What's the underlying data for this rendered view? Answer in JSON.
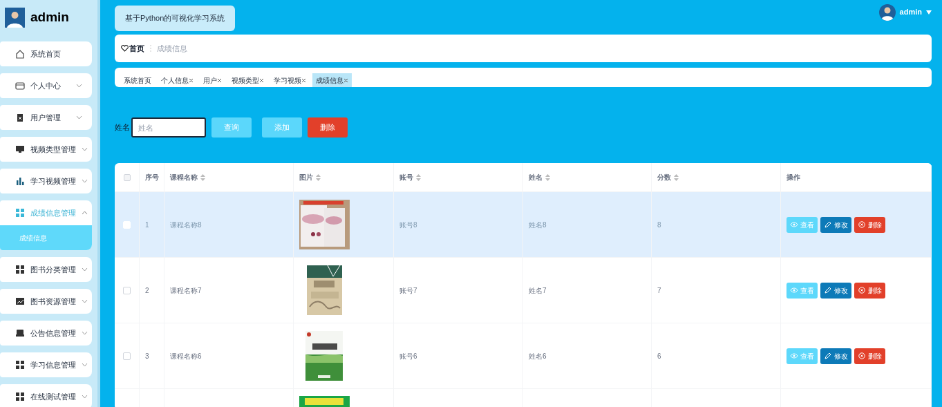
{
  "sidebar": {
    "user": "admin",
    "items": [
      {
        "label": "系统首页",
        "expandable": false,
        "expanded": false
      },
      {
        "label": "个人中心",
        "expandable": true,
        "expanded": false
      },
      {
        "label": "用户管理",
        "expandable": true,
        "expanded": false
      },
      {
        "label": "视频类型管理",
        "expandable": true,
        "expanded": false
      },
      {
        "label": "学习视频管理",
        "expandable": true,
        "expanded": false
      },
      {
        "label": "成绩信息管理",
        "expandable": true,
        "expanded": true,
        "children": [
          {
            "label": "成绩信息",
            "selected": true
          }
        ]
      },
      {
        "label": "图书分类管理",
        "expandable": true,
        "expanded": false
      },
      {
        "label": "图书资源管理",
        "expandable": true,
        "expanded": false
      },
      {
        "label": "公告信息管理",
        "expandable": true,
        "expanded": false
      },
      {
        "label": "学习信息管理",
        "expandable": true,
        "expanded": false
      },
      {
        "label": "在线测试管理",
        "expandable": true,
        "expanded": false
      }
    ]
  },
  "header": {
    "title": "基于Python的可视化学习系统",
    "user": "admin"
  },
  "breadcrumb": [
    "首页",
    "成绩信息"
  ],
  "tags": [
    {
      "label": "系统首页",
      "closable": false,
      "selected": false
    },
    {
      "label": "个人信息",
      "closable": true,
      "selected": false
    },
    {
      "label": "用户",
      "closable": true,
      "selected": false
    },
    {
      "label": "视频类型",
      "closable": true,
      "selected": false
    },
    {
      "label": "学习视频",
      "closable": true,
      "selected": false
    },
    {
      "label": "成绩信息",
      "closable": true,
      "selected": true
    }
  ],
  "search": {
    "label": "姓名",
    "placeholder": "姓名",
    "buttons": [
      {
        "label": "查询",
        "kind": "query"
      },
      {
        "label": "添加",
        "kind": "add"
      },
      {
        "label": "删除",
        "kind": "delete"
      }
    ]
  },
  "table": {
    "all_checked": false,
    "columns": [
      {
        "label": "序号",
        "sortable": false
      },
      {
        "label": "课程名称",
        "sortable": true
      },
      {
        "label": "图片",
        "sortable": true
      },
      {
        "label": "账号",
        "sortable": true
      },
      {
        "label": "姓名",
        "sortable": true
      },
      {
        "label": "分数",
        "sortable": true
      },
      {
        "label": "操作",
        "sortable": false
      }
    ],
    "rows": [
      {
        "index": "1",
        "course": "课程名称8",
        "picture": {
          "kind": "picture"
        },
        "account": "账号8",
        "name": "姓名8",
        "score": "8",
        "actions": [
          "查看",
          "修改",
          "删除"
        ],
        "highlighted": true,
        "checked": false
      },
      {
        "index": "2",
        "course": "课程名称7",
        "picture": {
          "kind": "picture"
        },
        "account": "账号7",
        "name": "姓名7",
        "score": "7",
        "actions": [
          "查看",
          "修改",
          "删除"
        ],
        "highlighted": false,
        "checked": false
      },
      {
        "index": "3",
        "course": "课程名称6",
        "picture": {
          "kind": "picture"
        },
        "account": "账号6",
        "name": "姓名6",
        "score": "6",
        "actions": [
          "查看",
          "修改",
          "删除"
        ],
        "highlighted": false,
        "checked": false
      },
      {
        "picture": {
          "kind": "picture"
        },
        "highlighted": false
      }
    ]
  }
}
